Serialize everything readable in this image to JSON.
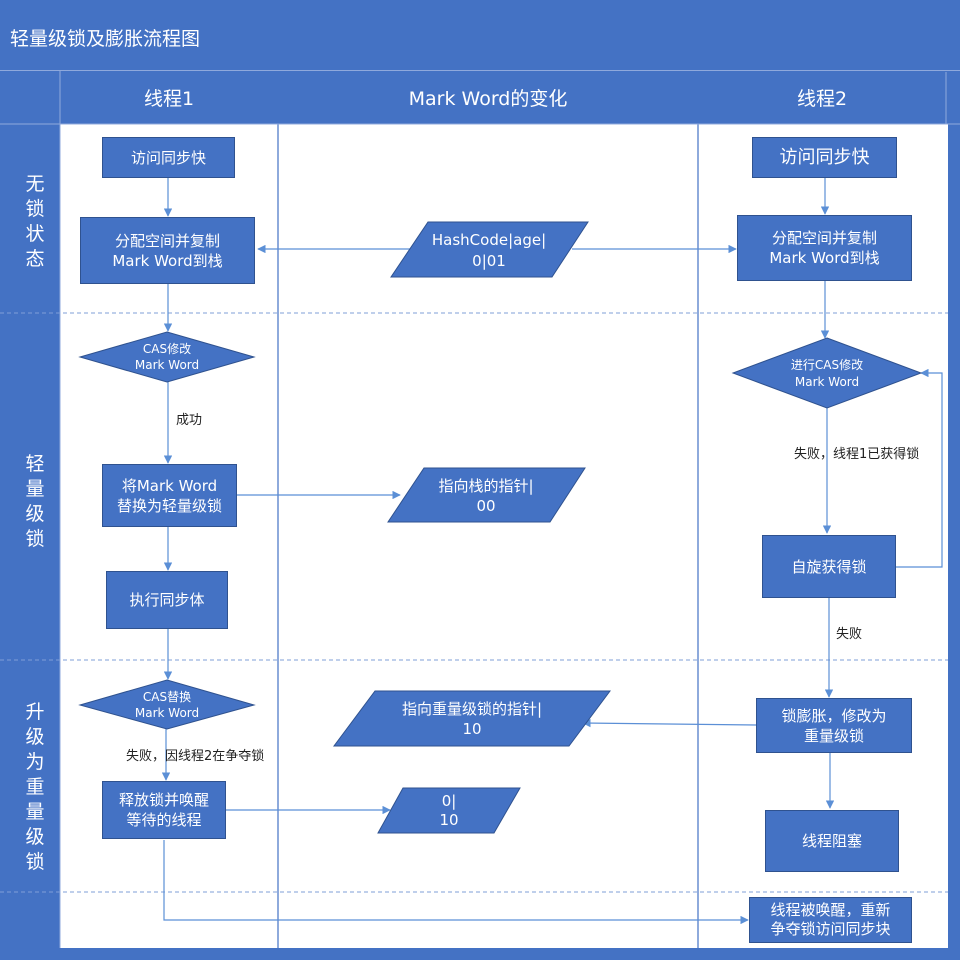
{
  "title": "轻量级锁及膨胀流程图",
  "columns": {
    "thread1": "线程1",
    "markword": "Mark Word的变化",
    "thread2": "线程2"
  },
  "rows": {
    "unlocked": "无锁状态",
    "lightweight": "轻量级锁",
    "upgrade": "升级为重量级锁"
  },
  "thread1": {
    "access_sync_block": "访问同步快",
    "alloc_line1": "分配空间并复制",
    "alloc_line2": "Mark Word到栈",
    "cas_line1": "CAS修改",
    "cas_line2": "Mark Word",
    "success_label": "成功",
    "replace_line1": "将Mark Word",
    "replace_line2": "替换为轻量级锁",
    "execute_sync_body": "执行同步体",
    "cas_replace_line1": "CAS替换",
    "cas_replace_line2": "Mark Word",
    "fail_label": "失败，因线程2在争夺锁",
    "release_line1": "释放锁并唤醒",
    "release_line2": "等待的线程"
  },
  "markword": {
    "hash_line1": "HashCode|age|",
    "hash_line2": "0|01",
    "stack_ptr_line1": "指向栈的指针|",
    "stack_ptr_line2": "00",
    "heavy_ptr_line1": "指向重量级锁的指针|",
    "heavy_ptr_line2": "10",
    "unlock_line1": "0|",
    "unlock_line2": "10"
  },
  "thread2": {
    "access_sync_block": "访问同步快",
    "alloc_line1": "分配空间并复制",
    "alloc_line2": "Mark Word到栈",
    "cas_line1": "进行CAS修改",
    "cas_line2": "Mark Word",
    "fail_label": "失败，线程1已获得锁",
    "spin": "自旋获得锁",
    "fail_label2": "失败",
    "inflate_line1": "锁膨胀，修改为",
    "inflate_line2": "重量级锁",
    "blocked": "线程阻塞",
    "woken_line1": "线程被唤醒，重新",
    "woken_line2": "争夺锁访问同步块"
  },
  "colors": {
    "background": "#4472c4",
    "panel": "#ffffff",
    "shape_fill": "#4472c4",
    "arrow": "#5b8fd6"
  }
}
